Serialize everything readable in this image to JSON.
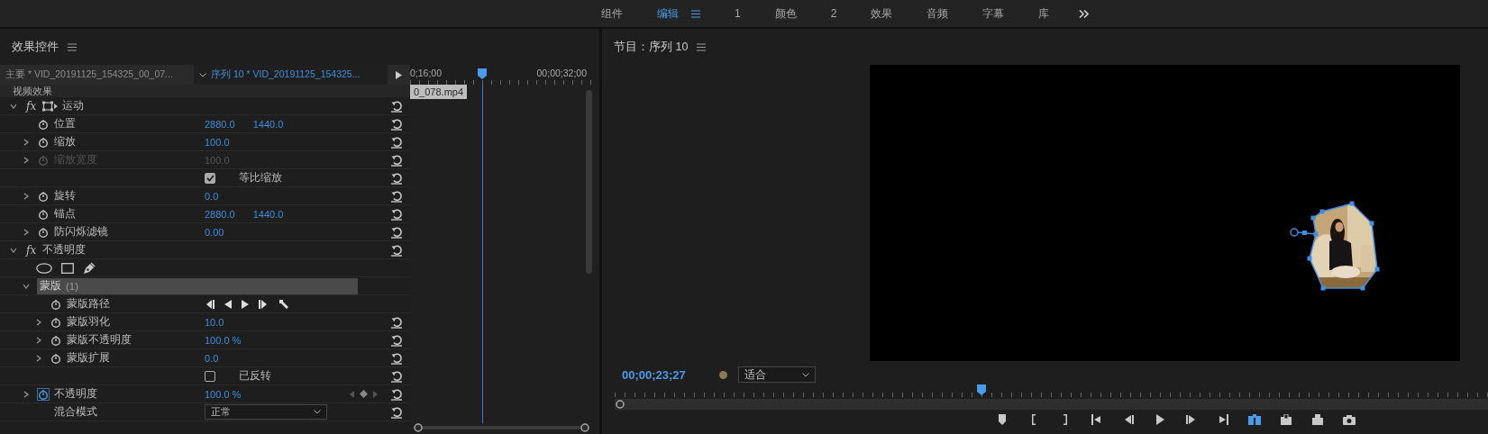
{
  "workspace_bar": {
    "tabs": [
      {
        "label": "组件",
        "selected": false
      },
      {
        "label": "编辑",
        "selected": true
      },
      {
        "label": "1",
        "selected": false
      },
      {
        "label": "颜色",
        "selected": false
      },
      {
        "label": "2",
        "selected": false
      },
      {
        "label": "效果",
        "selected": false
      },
      {
        "label": "音频",
        "selected": false
      },
      {
        "label": "字幕",
        "selected": false
      },
      {
        "label": "库",
        "selected": false
      }
    ]
  },
  "effect_controls": {
    "title": "效果控件",
    "clip_tabs": [
      {
        "label": "主要 * VID_20191125_154325_00_07...",
        "selected": false
      },
      {
        "label": "序列 10 * VID_20191125_154325...",
        "selected": true
      }
    ],
    "ruler_labels": [
      "0;16;00",
      "00;00;32;00"
    ],
    "playhead": {
      "level": 0.38
    },
    "clip": "0_078.mp4",
    "group_heading": "视频效果",
    "effects": [
      {
        "kind": "effect",
        "toggle": "fx",
        "label": "运动",
        "expanded": true,
        "transform_icon": true,
        "children": [
          {
            "kind": "property",
            "label": "位置",
            "values": [
              "2880.0",
              "1440.0"
            ],
            "expandable": false,
            "disabled": false,
            "animated": false
          },
          {
            "kind": "property",
            "label": "缩放",
            "values": [
              "100.0"
            ],
            "expandable": true,
            "disabled": false,
            "animated": false
          },
          {
            "kind": "property",
            "label": "缩放宽度",
            "values": [
              "100.0"
            ],
            "expandable": true,
            "disabled": true,
            "animated": false
          },
          {
            "kind": "checkbox",
            "label": "等比缩放",
            "checked": true
          },
          {
            "kind": "property",
            "label": "旋转",
            "values": [
              "0.0"
            ],
            "expandable": true,
            "disabled": false,
            "animated": false
          },
          {
            "kind": "property",
            "label": "锚点",
            "values": [
              "2880.0",
              "1440.0"
            ],
            "expandable": false,
            "disabled": false,
            "animated": false
          },
          {
            "kind": "property",
            "label": "防闪烁滤镜",
            "values": [
              "0.00"
            ],
            "expandable": true,
            "disabled": false,
            "animated": false
          }
        ]
      },
      {
        "kind": "effect",
        "toggle": "fx",
        "label": "不透明度",
        "expanded": true,
        "transform_icon": false,
        "children": [
          {
            "kind": "mask_tools"
          },
          {
            "kind": "mask",
            "label": "蒙版",
            "count": "(1)",
            "expanded": true,
            "selected": true,
            "children": [
              {
                "kind": "mask_path",
                "label": "蒙版路径"
              },
              {
                "kind": "property",
                "label": "蒙版羽化",
                "values": [
                  "10.0"
                ],
                "expandable": true,
                "disabled": false,
                "animated": false
              },
              {
                "kind": "property",
                "label": "蒙版不透明度",
                "values": [
                  "100.0 %"
                ],
                "expandable": true,
                "disabled": false,
                "animated": false
              },
              {
                "kind": "property",
                "label": "蒙版扩展",
                "values": [
                  "0.0"
                ],
                "expandable": true,
                "disabled": false,
                "animated": false
              },
              {
                "kind": "checkbox",
                "label": "已反转",
                "checked": false
              }
            ]
          },
          {
            "kind": "property",
            "label": "不透明度",
            "values": [
              "100.0 %"
            ],
            "expandable": true,
            "disabled": false,
            "animated": true
          },
          {
            "kind": "dropdown",
            "label": "混合模式",
            "value": "正常"
          }
        ]
      }
    ]
  },
  "program_monitor": {
    "title": "节目：序列 10",
    "timecode": "00;00;23;27",
    "zoom": "适合",
    "playhead": {
      "level": 0.42
    }
  }
}
